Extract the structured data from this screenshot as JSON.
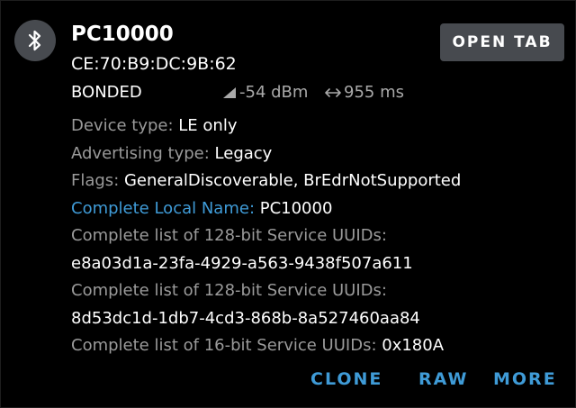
{
  "device": {
    "name": "PC10000",
    "address": "CE:70:B9:DC:9B:62",
    "bond_state": "BONDED",
    "rssi": "-54 dBm",
    "interval": "955 ms",
    "icon": "bluetooth-icon"
  },
  "header": {
    "open_tab_label": "OPEN TAB"
  },
  "details": [
    {
      "label": "Device type: ",
      "value": "LE only",
      "highlight": false
    },
    {
      "label": "Advertising type: ",
      "value": "Legacy",
      "highlight": false
    },
    {
      "label": "Flags: ",
      "value": "GeneralDiscoverable, BrEdrNotSupported",
      "highlight": false
    },
    {
      "label": "Complete Local Name: ",
      "value": "PC10000",
      "highlight": true
    },
    {
      "label": "Complete list of 128-bit Service UUIDs:",
      "value": "",
      "highlight": false
    },
    {
      "label": "",
      "value": "e8a03d1a-23fa-4929-a563-9438f507a611",
      "highlight": false
    },
    {
      "label": "Complete list of 128-bit Service UUIDs:",
      "value": "",
      "highlight": false
    },
    {
      "label": "",
      "value": "8d53dc1d-1db7-4cd3-868b-8a527460aa84",
      "highlight": false
    },
    {
      "label": "Complete list of 16-bit Service UUIDs: ",
      "value": "0x180A",
      "highlight": false
    }
  ],
  "actions": {
    "clone": "CLONE",
    "raw": "RAW",
    "more": "MORE"
  },
  "colors": {
    "accent": "#3f9bd7",
    "label_gray": "#9a9a9a",
    "button_bg": "#474a4f",
    "background": "#000000"
  }
}
